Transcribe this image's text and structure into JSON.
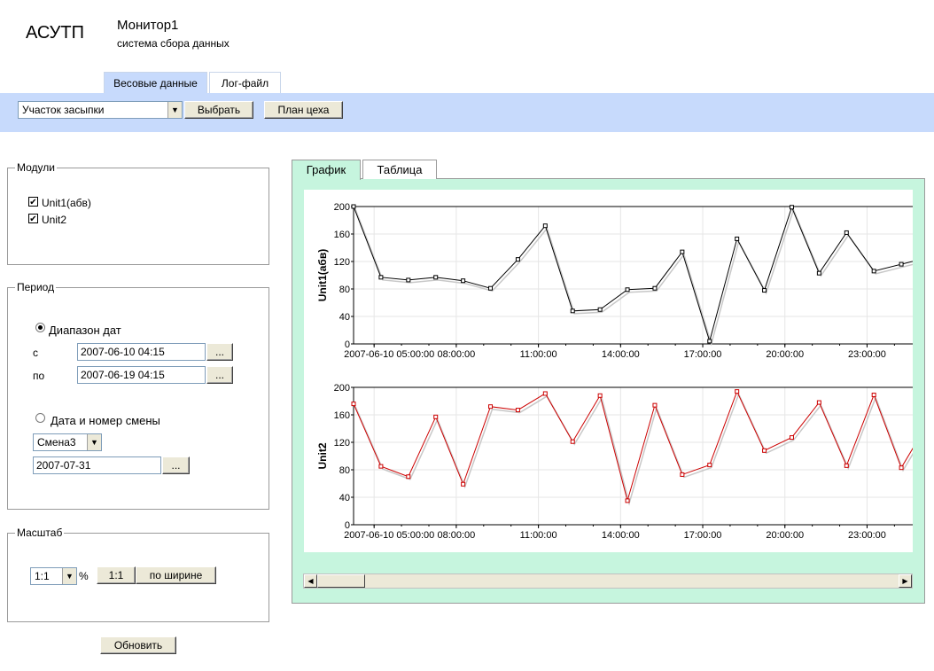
{
  "header": {
    "logo": "АСУТП",
    "title": "Монитор1",
    "subtitle": "система сбора данных"
  },
  "top_tabs": [
    {
      "label": "Весовые данные",
      "active": true
    },
    {
      "label": "Лог-файл",
      "active": false
    }
  ],
  "toolbar": {
    "section_select": "Участок засыпки",
    "select_button": "Выбрать",
    "plan_button": "План цеха"
  },
  "modules": {
    "legend": "Модули",
    "items": [
      {
        "label": "Unit1(абв)",
        "checked": true
      },
      {
        "label": "Unit2",
        "checked": true
      }
    ]
  },
  "period": {
    "legend": "Период",
    "range_option": "Диапазон дат",
    "range_selected": true,
    "from_label": "с",
    "from_value": "2007-06-10 04:15",
    "to_label": "по",
    "to_value": "2007-06-19 04:15",
    "browse_label": "...",
    "shift_option": "Дата и номер смены",
    "shift_select": "Смена3",
    "shift_date": "2007-07-31"
  },
  "scale": {
    "legend": "Масштаб",
    "select": "1:1",
    "percent": "%",
    "one_to_one_button": "1:1",
    "fit_width_button": "по ширине"
  },
  "refresh_button": "Обновить",
  "chart_tabs": [
    {
      "label": "График",
      "active": true
    },
    {
      "label": "Таблица",
      "active": false
    }
  ],
  "chart_data": [
    {
      "type": "line",
      "ylabel": "Unit1(абв)",
      "ylim": [
        0,
        200
      ],
      "yticks": [
        0,
        40,
        80,
        120,
        160,
        200
      ],
      "x_tick_labels": [
        "2007-06-10 05:00:00",
        "08:00:00",
        "11:00:00",
        "14:00:00",
        "17:00:00",
        "20:00:00",
        "23:00:00"
      ],
      "x_tick_hours": [
        5,
        8,
        11,
        14,
        17,
        20,
        23
      ],
      "x_start_hour": 4.25,
      "x_end_hour": 24.7,
      "color": "#000000",
      "series": [
        {
          "x": [
            4.25,
            5.25,
            6.25,
            7.25,
            8.25,
            9.25,
            10.25,
            11.25,
            12.25,
            13.25,
            14.25,
            15.25,
            16.25,
            17.25,
            18.25,
            19.25,
            20.25,
            21.25,
            22.25,
            23.25,
            24.25,
            25.25
          ],
          "y": [
            200,
            97,
            93,
            97,
            92,
            81,
            123,
            172,
            48,
            50,
            79,
            81,
            134,
            4,
            153,
            78,
            199,
            103,
            162,
            106,
            116,
            126
          ]
        }
      ]
    },
    {
      "type": "line",
      "ylabel": "Unit2",
      "ylim": [
        0,
        200
      ],
      "yticks": [
        0,
        40,
        80,
        120,
        160,
        200
      ],
      "x_tick_labels": [
        "2007-06-10 05:00:00",
        "08:00:00",
        "11:00:00",
        "14:00:00",
        "17:00:00",
        "20:00:00",
        "23:00:00"
      ],
      "x_tick_hours": [
        5,
        8,
        11,
        14,
        17,
        20,
        23
      ],
      "x_start_hour": 4.25,
      "x_end_hour": 24.7,
      "color": "#cc0000",
      "series": [
        {
          "x": [
            4.25,
            5.25,
            6.25,
            7.25,
            8.25,
            9.25,
            10.25,
            11.25,
            12.25,
            13.25,
            14.25,
            15.25,
            16.25,
            17.25,
            18.25,
            19.25,
            20.25,
            21.25,
            22.25,
            23.25,
            24.25,
            25.25
          ],
          "y": [
            176,
            85,
            70,
            157,
            59,
            172,
            167,
            191,
            121,
            188,
            35,
            174,
            73,
            87,
            194,
            108,
            127,
            178,
            86,
            189,
            83,
            150
          ]
        }
      ]
    }
  ]
}
